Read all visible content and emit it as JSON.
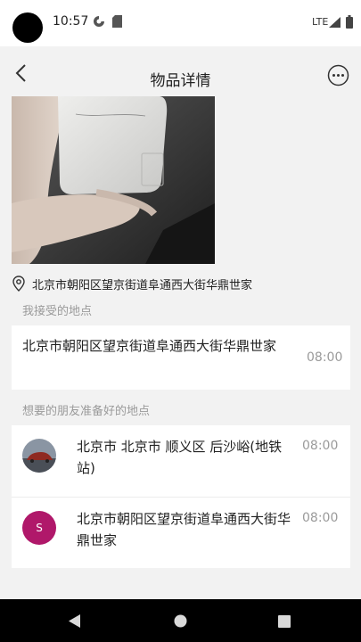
{
  "status": {
    "time": "10:57",
    "network": "LTE"
  },
  "header": {
    "title": "物品详情"
  },
  "item": {
    "location": "北京市朝阳区望京街道阜通西大街华鼎世家"
  },
  "accepted": {
    "label": "我接受的地点",
    "address": "北京市朝阳区望京街道阜通西大街华鼎世家",
    "time": "08:00"
  },
  "friends": {
    "label": "想要的朋友准备好的地点",
    "items": [
      {
        "address": "北京市 北京市 顺义区 后沙峪(地铁站)",
        "time": "08:00"
      },
      {
        "avatar_letter": "S",
        "address": "北京市朝阳区望京街道阜通西大街华鼎世家",
        "time": "08:00"
      }
    ]
  },
  "colors": {
    "accent_avatar": "#b0186a",
    "background": "#f2f2f2"
  }
}
